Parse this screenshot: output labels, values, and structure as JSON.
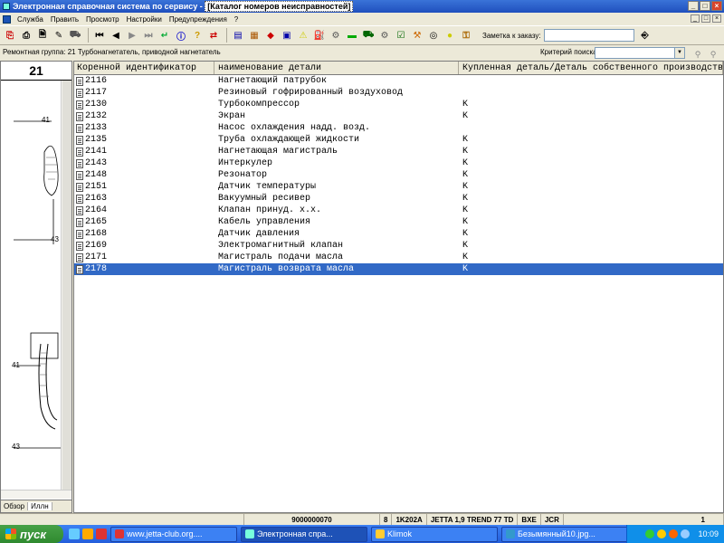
{
  "window": {
    "title_main": "Электронная справочная система по сервису - ",
    "title_sub": "[Каталог номеров неисправностей]"
  },
  "menu": [
    "Служба",
    "Править",
    "Просмотр",
    "Настройки",
    "Предупреждения",
    "?"
  ],
  "toolbar": {
    "note_label": "Заметка к заказу:",
    "note_value": ""
  },
  "info": {
    "repair_group": "Ремонтная группа: 21 Турбонагнетатель, приводной нагнетатель",
    "search_label": "Критерий поиска:",
    "search_value": ""
  },
  "left_panel": {
    "group_number": "21",
    "callouts": [
      "41",
      "43",
      "41",
      "43"
    ],
    "tabs": [
      "Обзор",
      "Иллн"
    ]
  },
  "table": {
    "columns": [
      "Коренной идентификатор",
      "наименование детали",
      "Купленная деталь/Деталь собственного производства"
    ],
    "rows": [
      {
        "id": "2116",
        "name": "Нагнетающий патрубок",
        "flag": ""
      },
      {
        "id": "2117",
        "name": "Резиновый гофрированный воздуховод",
        "flag": ""
      },
      {
        "id": "2130",
        "name": "Турбокомпрессор",
        "flag": "K"
      },
      {
        "id": "2132",
        "name": "Экран",
        "flag": "K"
      },
      {
        "id": "2133",
        "name": "Насос охлаждения надд. возд.",
        "flag": ""
      },
      {
        "id": "2135",
        "name": "Труба охлаждающей жидкости",
        "flag": "K"
      },
      {
        "id": "2141",
        "name": "Нагнетающая магистраль",
        "flag": "K"
      },
      {
        "id": "2143",
        "name": "Интеркулер",
        "flag": "K"
      },
      {
        "id": "2148",
        "name": "Резонатор",
        "flag": "K"
      },
      {
        "id": "2151",
        "name": "Датчик температуры",
        "flag": "K"
      },
      {
        "id": "2163",
        "name": "Вакуумный ресивер",
        "flag": "K"
      },
      {
        "id": "2164",
        "name": "Клапан принуд. х.х.",
        "flag": "K"
      },
      {
        "id": "2165",
        "name": "Кабель управления",
        "flag": "K"
      },
      {
        "id": "2168",
        "name": "Датчик давления",
        "flag": "K"
      },
      {
        "id": "2169",
        "name": "Электромагнитный клапан",
        "flag": "K"
      },
      {
        "id": "2171",
        "name": "Магистраль подачи масла",
        "flag": "K"
      },
      {
        "id": "2178",
        "name": "Магистраль возврата масла",
        "flag": "K",
        "selected": true
      }
    ]
  },
  "status": {
    "order_no": "9000000070",
    "num": "8",
    "model_code": "1K202A",
    "model": "JETTA 1,9 TREND 77 TD",
    "engine": "BXE",
    "gearbox": "JCR",
    "page": "1"
  },
  "taskbar": {
    "start": "пуск",
    "tasks": [
      {
        "label": "www.jetta-club.org....",
        "color": "#d33"
      },
      {
        "label": "Электронная спра...",
        "color": "#7fd",
        "active": true
      },
      {
        "label": "Klimok",
        "color": "#fc3"
      },
      {
        "label": "Безымянный10.jpg...",
        "color": "#39c"
      }
    ],
    "clock": "10:09"
  }
}
